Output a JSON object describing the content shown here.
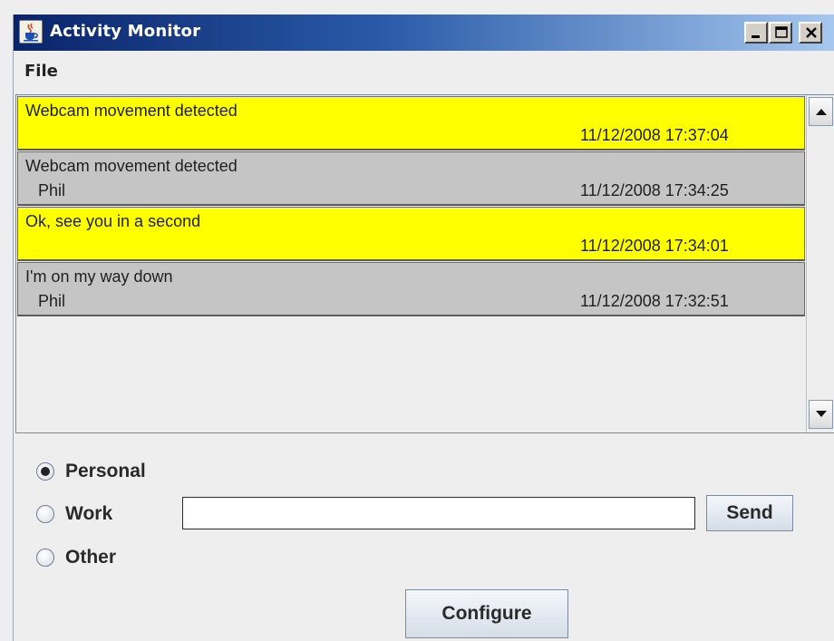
{
  "window": {
    "title": "Activity Monitor",
    "icon": "java-cup-icon",
    "controls": [
      "minimize-icon",
      "maximize-icon",
      "close-icon"
    ]
  },
  "menu": {
    "items": [
      {
        "label": "File"
      }
    ]
  },
  "messages": [
    {
      "text": "Webcam movement detected",
      "sender": "",
      "timestamp": "11/12/2008 17:37:04",
      "color": "#ffff00"
    },
    {
      "text": "Webcam movement detected",
      "sender": "Phil",
      "timestamp": "11/12/2008 17:34:25",
      "color": "#c5c5c5"
    },
    {
      "text": "Ok, see you in a second",
      "sender": "",
      "timestamp": "11/12/2008 17:34:01",
      "color": "#ffff00"
    },
    {
      "text": "I'm on my way down",
      "sender": "Phil",
      "timestamp": "11/12/2008 17:32:51",
      "color": "#c5c5c5"
    }
  ],
  "categories": {
    "options": [
      "Personal",
      "Work",
      "Other"
    ],
    "selected": "Personal"
  },
  "input": {
    "value": "",
    "placeholder": ""
  },
  "buttons": {
    "send": "Send",
    "configure": "Configure"
  }
}
